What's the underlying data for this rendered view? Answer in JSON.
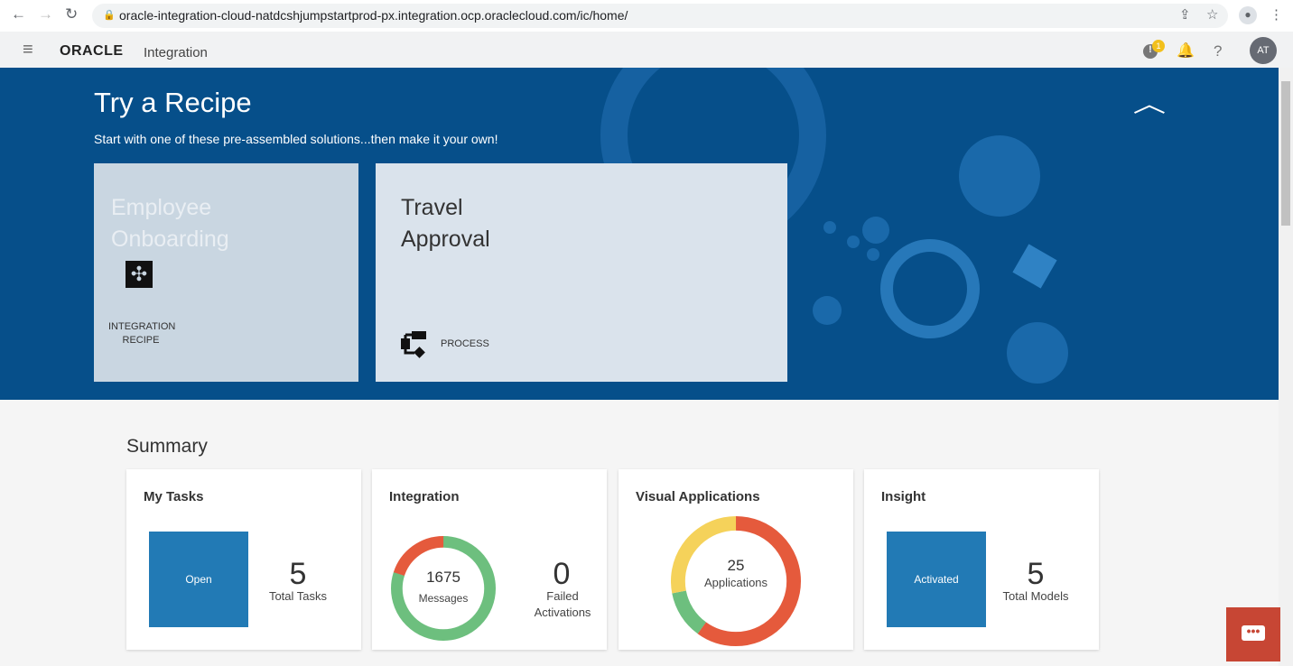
{
  "browser": {
    "url": "oracle-integration-cloud-natdcshjumpstartprod-px.integration.ocp.oraclecloud.com/ic/home/"
  },
  "header": {
    "logo": "ORACLE",
    "product": "Integration",
    "notification_badge": "1",
    "help": "?",
    "avatar": "AT"
  },
  "banner": {
    "title": "Try a Recipe",
    "subtitle": "Start with one of these pre-assembled solutions...then make it your own!",
    "tiles": [
      {
        "title_line1": "Employee",
        "title_line2": "Onboarding",
        "type_line1": "INTEGRATION",
        "type_line2": "RECIPE",
        "icon": "puzzle-icon"
      },
      {
        "title_line1": "Travel",
        "title_line2": "Approval",
        "type": "PROCESS",
        "icon": "process-flow-icon"
      }
    ]
  },
  "summary": {
    "title": "Summary",
    "cards": [
      {
        "title": "My Tasks",
        "box_label": "Open",
        "value": "5",
        "label": "Total Tasks"
      },
      {
        "title": "Integration",
        "donut_value": "1675",
        "donut_label": "Messages",
        "value": "0",
        "label_line1": "Failed",
        "label_line2": "Activations",
        "segments": [
          {
            "color": "#6dbf7e",
            "fraction": 0.8
          },
          {
            "color": "#e55a3c",
            "fraction": 0.2
          }
        ]
      },
      {
        "title": "Visual Applications",
        "donut_value": "25",
        "donut_label": "Applications",
        "segments": [
          {
            "color": "#e55a3c",
            "fraction": 0.6
          },
          {
            "color": "#6dbf7e",
            "fraction": 0.12
          },
          {
            "color": "#f5d25a",
            "fraction": 0.28
          }
        ]
      },
      {
        "title": "Insight",
        "box_label": "Activated",
        "value": "5",
        "label": "Total Models"
      }
    ]
  },
  "colors": {
    "banner": "#064f8a",
    "accent": "#227ab5",
    "chat": "#c74634"
  }
}
